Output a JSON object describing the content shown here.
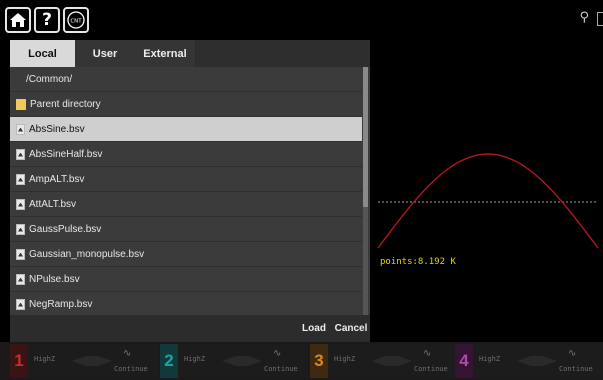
{
  "topbar": {
    "home_icon": "home-icon",
    "help_label": "?",
    "cnt_label": "CNT",
    "usb_icon": "usb-icon",
    "battery_icon": "battery-icon"
  },
  "tabs": [
    {
      "label": "Local",
      "active": true
    },
    {
      "label": "User",
      "active": false
    },
    {
      "label": "External",
      "active": false
    }
  ],
  "browser": {
    "path": "/Common/",
    "items": [
      {
        "label": "Parent directory",
        "type": "folder",
        "selected": false
      },
      {
        "label": "AbsSine.bsv",
        "type": "file",
        "selected": true
      },
      {
        "label": "AbsSineHalf.bsv",
        "type": "file",
        "selected": false
      },
      {
        "label": "AmpALT.bsv",
        "type": "file",
        "selected": false
      },
      {
        "label": "AttALT.bsv",
        "type": "file",
        "selected": false
      },
      {
        "label": "GaussPulse.bsv",
        "type": "file",
        "selected": false
      },
      {
        "label": "Gaussian_monopulse.bsv",
        "type": "file",
        "selected": false
      },
      {
        "label": "NPulse.bsv",
        "type": "file",
        "selected": false
      },
      {
        "label": "NegRamp.bsv",
        "type": "file",
        "selected": false
      }
    ],
    "load_label": "Load",
    "cancel_label": "Cancel"
  },
  "preview": {
    "points_text": "points:8.192 K",
    "wave_color": "#b01818",
    "midline_color": "#aaaaaa"
  },
  "channels": [
    {
      "num": "1",
      "color": "#c0302a",
      "impedance": "HighZ",
      "mode": "Continue"
    },
    {
      "num": "2",
      "color": "#1aa3a6",
      "impedance": "HighZ",
      "mode": "Continue"
    },
    {
      "num": "3",
      "color": "#d98a1c",
      "impedance": "HighZ",
      "mode": "Continue"
    },
    {
      "num": "4",
      "color": "#b04aa8",
      "impedance": "HighZ",
      "mode": "Continue"
    }
  ]
}
